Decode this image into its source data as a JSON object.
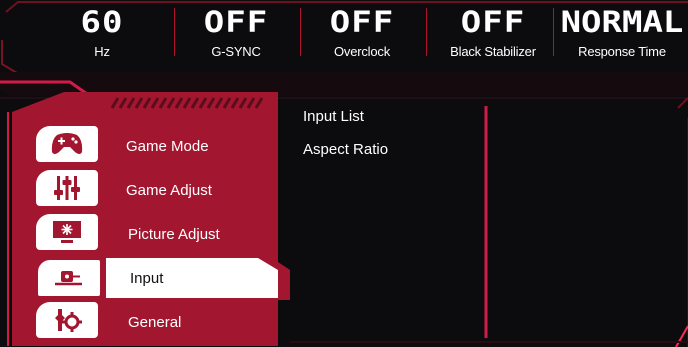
{
  "status_bar": [
    {
      "value": "60",
      "label": "Hz"
    },
    {
      "value": "OFF",
      "label": "G-SYNC"
    },
    {
      "value": "OFF",
      "label": "Overclock"
    },
    {
      "value": "OFF",
      "label": "Black Stabilizer"
    },
    {
      "value": "NORMAL",
      "label": "Response Time"
    }
  ],
  "menu": {
    "items": [
      {
        "label": "Game Mode",
        "icon": "gamepad-icon",
        "active": false
      },
      {
        "label": "Game Adjust",
        "icon": "sliders-icon",
        "active": false
      },
      {
        "label": "Picture Adjust",
        "icon": "monitor-icon",
        "active": false
      },
      {
        "label": "Input",
        "icon": "input-plug-icon",
        "active": true
      },
      {
        "label": "General",
        "icon": "wrench-gear-icon",
        "active": false
      }
    ]
  },
  "submenu": {
    "items": [
      "Input List",
      "Aspect Ratio"
    ]
  },
  "colors": {
    "accent_red": "#a3162f",
    "active_bg": "#ffffff",
    "background": "#0c0c0e"
  }
}
